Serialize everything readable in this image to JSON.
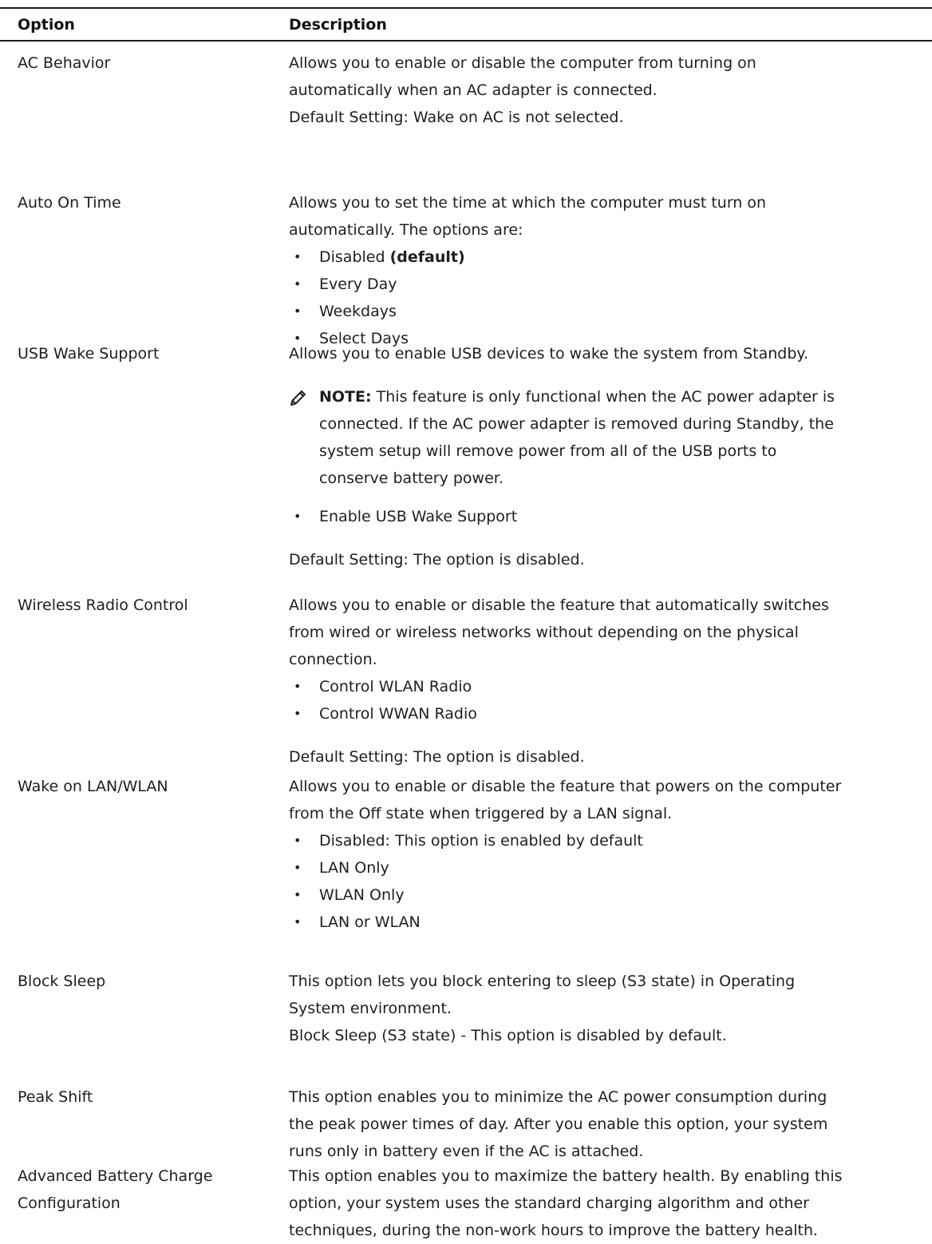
{
  "table": {
    "headers": {
      "option": "Option",
      "description": "Description"
    },
    "rows": [
      {
        "option": "AC Behavior",
        "lines": [
          "Allows you to enable or disable the computer from turning on",
          "automatically when an AC adapter is connected."
        ],
        "default": "Default Setting: Wake on AC is not selected."
      },
      {
        "option": "Auto On Time",
        "lines": [
          "Allows you to set the time at which the computer must turn on",
          "automatically. The options are:"
        ],
        "bullets": [
          "Disabled",
          "Every Day",
          "Weekdays",
          "Select Days"
        ],
        "bullet0_suffix": "(default)"
      },
      {
        "option": "USB Wake Support",
        "lines": [
          "Allows you to enable USB devices to wake the system from Standby."
        ],
        "note_title": "NOTE:",
        "note_lines": [
          "This feature is only functional when the AC power adapter is",
          "connected. If the AC power adapter is removed during Standby, the",
          "system setup will remove power from all of the USB ports to",
          "conserve battery power."
        ],
        "bullets": [
          "Enable USB Wake Support"
        ],
        "default": "Default Setting: The option is disabled."
      },
      {
        "option": "Wireless Radio Control",
        "lines": [
          "Allows you to enable or disable the feature that automatically switches",
          "from wired or wireless networks without depending on the physical",
          "connection."
        ],
        "bullets": [
          "Control WLAN Radio",
          "Control WWAN Radio"
        ],
        "default": "Default Setting: The option is disabled."
      },
      {
        "option": "Wake on LAN/WLAN",
        "lines": [
          "Allows you to enable or disable the feature that powers on the computer",
          "from the Off state when triggered by a LAN signal."
        ],
        "bullets": [
          "Disabled: This option is enabled by default",
          "LAN Only",
          "WLAN Only",
          "LAN or WLAN"
        ]
      },
      {
        "option": "Block Sleep",
        "lines": [
          "This option lets you block entering to sleep (S3 state) in Operating",
          "System environment."
        ],
        "default": "Block Sleep (S3 state) - This option is disabled by default."
      },
      {
        "option": "Peak Shift",
        "lines": [
          "This option enables you to minimize the AC power consumption during",
          "the peak power times of day. After you enable this option, your system",
          "runs only in battery even if the AC is attached."
        ]
      },
      {
        "option_lines": [
          "Advanced Battery Charge",
          "Configuration"
        ],
        "lines": [
          "This option enables you to maximize the battery health. By enabling this",
          "option, your system uses the standard charging algorithm and other",
          "techniques, during the non-work hours to improve the battery health."
        ]
      }
    ]
  },
  "icons": {
    "note": "pencil-note-icon"
  }
}
